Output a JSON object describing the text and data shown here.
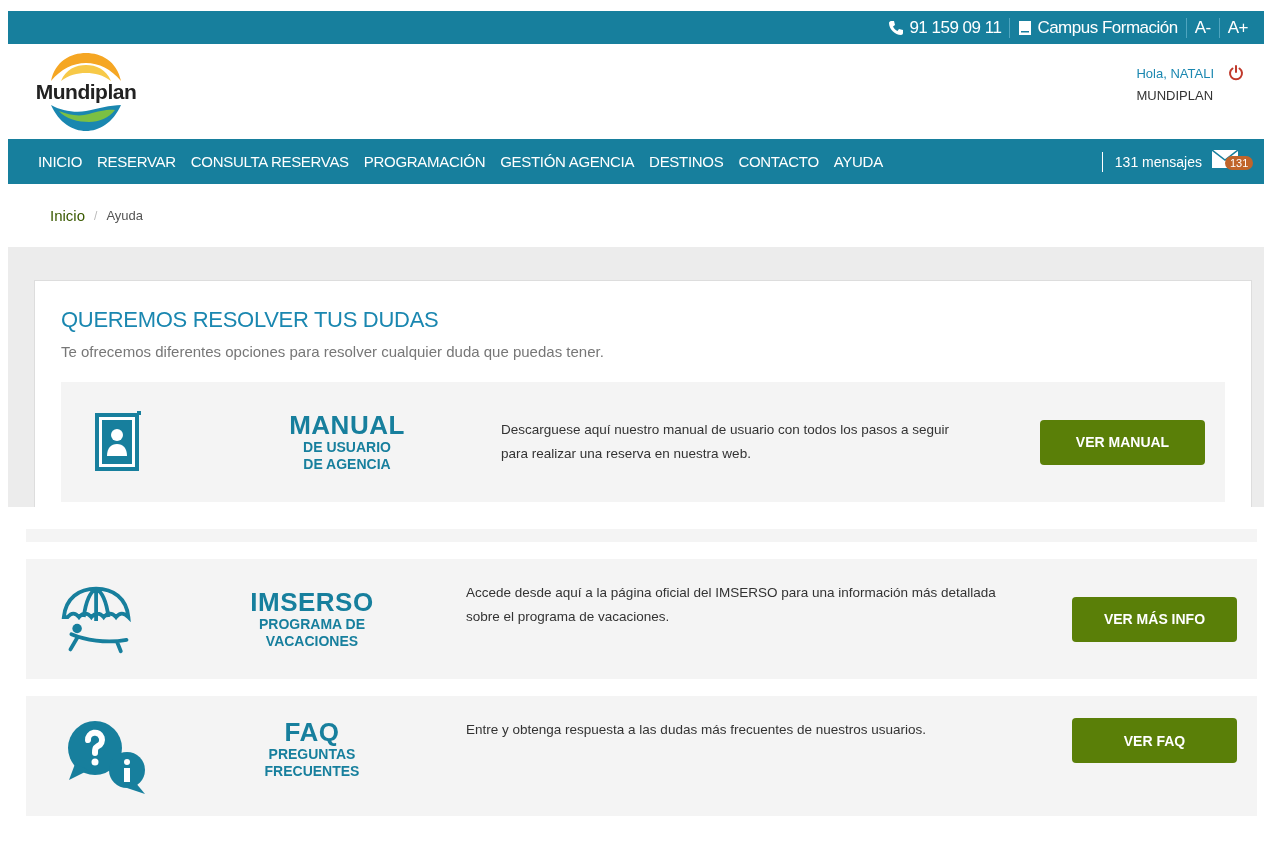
{
  "top_bar": {
    "phone": "91 159 09 11",
    "campus": "Campus Formación",
    "font_smaller": "A-",
    "font_larger": "A+"
  },
  "header": {
    "logo": "Mundiplan",
    "greeting": "Hola, NATALI",
    "company": "MUNDIPLAN"
  },
  "nav": {
    "items": [
      "INICIO",
      "RESERVAR",
      "CONSULTA RESERVAS",
      "PROGRAMACIÓN",
      "GESTIÓN AGENCIA",
      "DESTINOS",
      "CONTACTO",
      "AYUDA"
    ],
    "messages": "131 mensajes",
    "badge": "131"
  },
  "breadcrumb": {
    "separator": "/",
    "items": [
      {
        "label": "Inicio",
        "link": true
      },
      {
        "label": "Ayuda",
        "link": false
      }
    ]
  },
  "panel": {
    "title": "QUEREMOS RESOLVER TUS DUDAS",
    "subtitle": "Te ofrecemos diferentes opciones para resolver cualquier duda que puedas tener."
  },
  "cards": [
    {
      "kind": "manual",
      "title": "MANUAL",
      "subtitle": [
        "DE USUARIO",
        "DE AGENCIA"
      ],
      "description": "Descarguese aquí nuestro manual de usuario con todos los pasos a seguir para realizar una reserva en nuestra web.",
      "button": "VER MANUAL"
    },
    {
      "kind": "imserso",
      "title": "IMSERSO",
      "subtitle": [
        "PROGRAMA DE",
        "VACACIONES"
      ],
      "description": "Accede desde aquí a la página oficial del IMSERSO para una información más detallada sobre el programa de vacaciones.",
      "button": "VER MÁS INFO"
    },
    {
      "kind": "faq",
      "title": "FAQ",
      "subtitle": [
        "PREGUNTAS",
        "FRECUENTES"
      ],
      "description": "Entre y obtenga respuesta a las dudas más frecuentes de nuestros usuarios.",
      "button": "VER FAQ"
    }
  ]
}
